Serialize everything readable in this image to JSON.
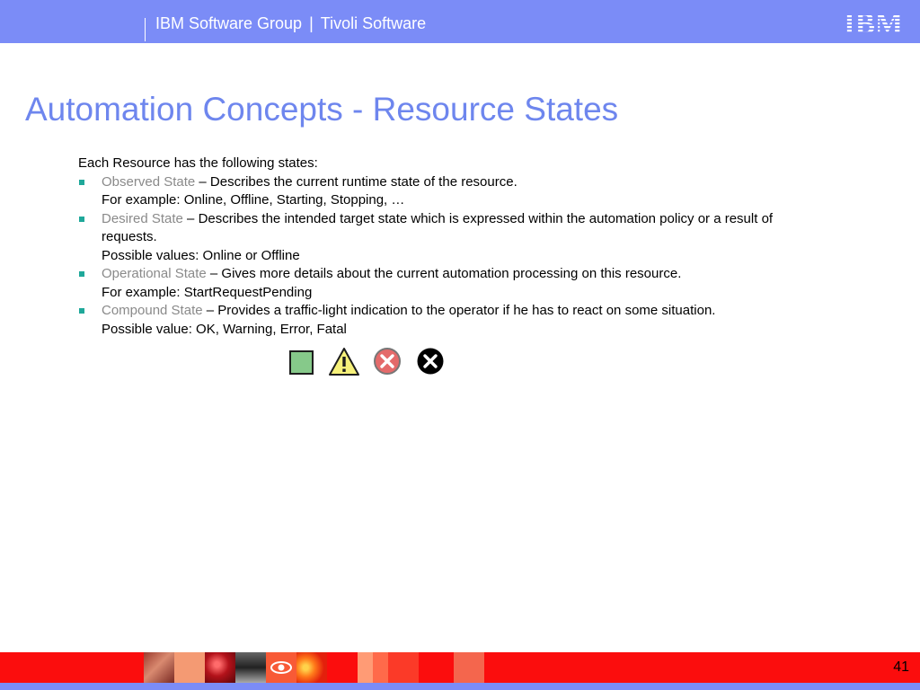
{
  "header": {
    "group": "IBM Software Group",
    "separator": "|",
    "product": "Tivoli Software",
    "logo": "IBM"
  },
  "title": "Automation Concepts - Resource States",
  "intro": "Each Resource has the following states:",
  "states": [
    {
      "term": "Observed State",
      "desc": " – Describes the current runtime state of the resource.",
      "detail": "For example: Online, Offline, Starting, Stopping, …"
    },
    {
      "term": "Desired State",
      "desc": " – Describes the intended target state which is expressed within the automation policy or a result of requests.",
      "detail": "Possible values: Online or Offline"
    },
    {
      "term": "Operational State",
      "desc": " – Gives more details about the current automation processing on this resource.",
      "detail": "For example: StartRequestPending"
    },
    {
      "term": "Compound State",
      "desc": " – Provides a traffic-light indication to the operator if he has to react on some situation.",
      "detail": "Possible value: OK, Warning, Error, Fatal"
    }
  ],
  "icons": [
    "ok-square-icon",
    "warning-triangle-icon",
    "error-circle-icon",
    "fatal-circle-icon"
  ],
  "colors": {
    "header": "#7b8cf7",
    "title": "#6e86ee",
    "term": "#8a8a8a",
    "bullet": "#1fa89a",
    "footer": "#fb0d0d"
  },
  "page_number": "41"
}
